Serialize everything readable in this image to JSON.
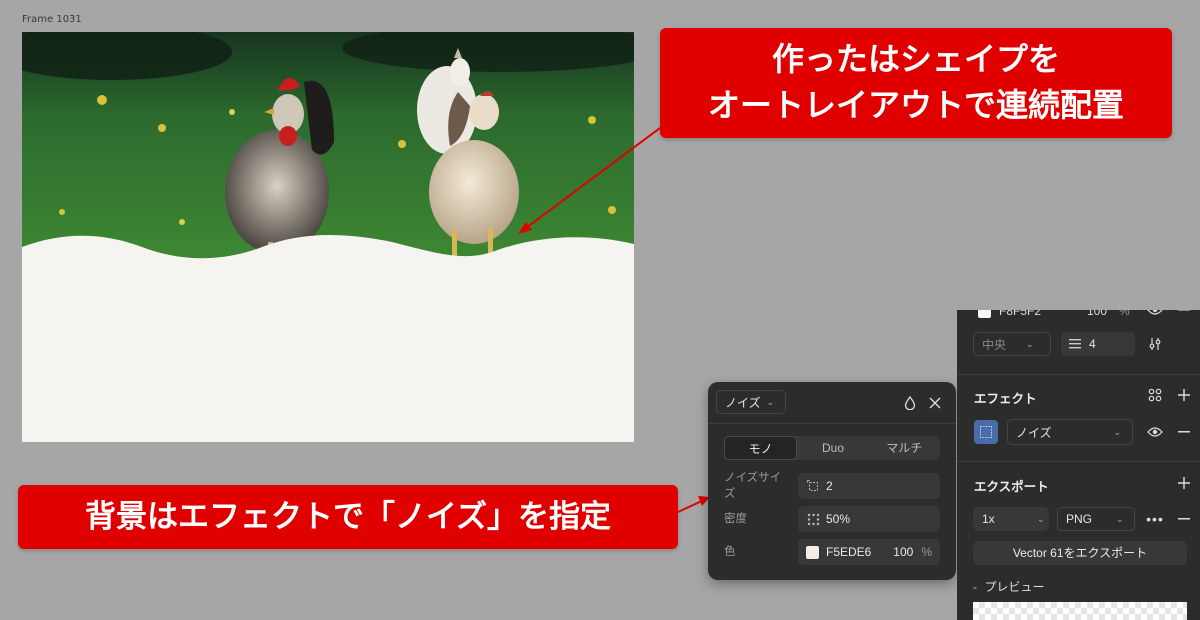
{
  "canvas": {
    "frame_label": "Frame 1031",
    "noise_color": "#F5EDE6"
  },
  "callouts": {
    "top_line1": "作ったはシェイプを",
    "top_line2": "オートレイアウトで連続配置",
    "bottom": "背景はエフェクトで「ノイズ」を指定",
    "color": "#E00000"
  },
  "noise_popup": {
    "type_select": "ノイズ",
    "tabs": [
      {
        "label": "モノ",
        "active": true
      },
      {
        "label": "Duo",
        "active": false
      },
      {
        "label": "マルチ",
        "active": false
      }
    ],
    "noise_size_label": "ノイズサイズ",
    "noise_size_value": "2",
    "density_label": "密度",
    "density_value": "50%",
    "color_label": "色",
    "color_hex": "F5EDE6",
    "color_opacity": "100",
    "percent_sign": "%",
    "icons": [
      "droplet-icon",
      "close-icon"
    ]
  },
  "design_panel": {
    "fill_hex": "F8F5F2",
    "fill_opacity": "100",
    "percent_sign": "%",
    "align_select": "中央",
    "layout_count": "4",
    "effects_title": "エフェクト",
    "effect_type": "ノイズ",
    "export_title": "エクスポート",
    "export_scale": "1x",
    "export_format": "PNG",
    "export_button": "Vector 61をエクスポート",
    "preview_label": "プレビュー"
  }
}
